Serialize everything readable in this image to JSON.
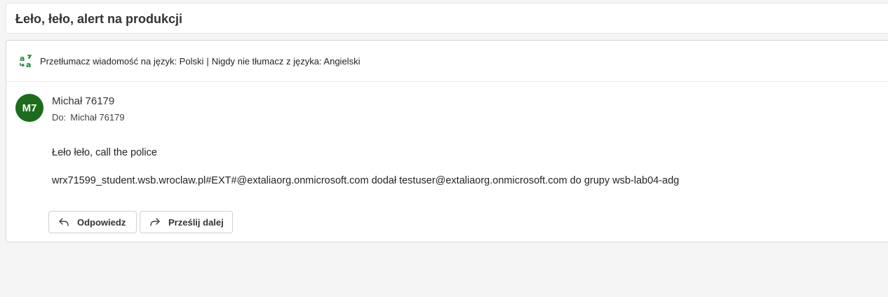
{
  "message": {
    "subject": "Łeło, łeło, alert na produkcji",
    "translate_bar": {
      "icon": "translate-icon",
      "translate_link": "Przetłumacz wiadomość na język: Polski",
      "separator": "|",
      "never_link": "Nigdy nie tłumacz z języka: Angielski"
    },
    "sender": {
      "initials": "M7",
      "avatar_color": "#1b6d1b",
      "name": "Michał 76179"
    },
    "recipients": {
      "label": "Do:",
      "value": "Michał 76179"
    },
    "body": [
      "Łeło łeło, call the police",
      "wrx71599_student.wsb.wroclaw.pl#EXT#@extaliaorg.onmicrosoft.com dodał testuser@extaliaorg.onmicrosoft.com do grupy wsb-lab04-adg"
    ],
    "actions": {
      "reply_label": "Odpowiedz",
      "reply_icon": "reply-arrow-icon",
      "forward_label": "Prześlij dalej",
      "forward_icon": "forward-arrow-icon"
    }
  }
}
